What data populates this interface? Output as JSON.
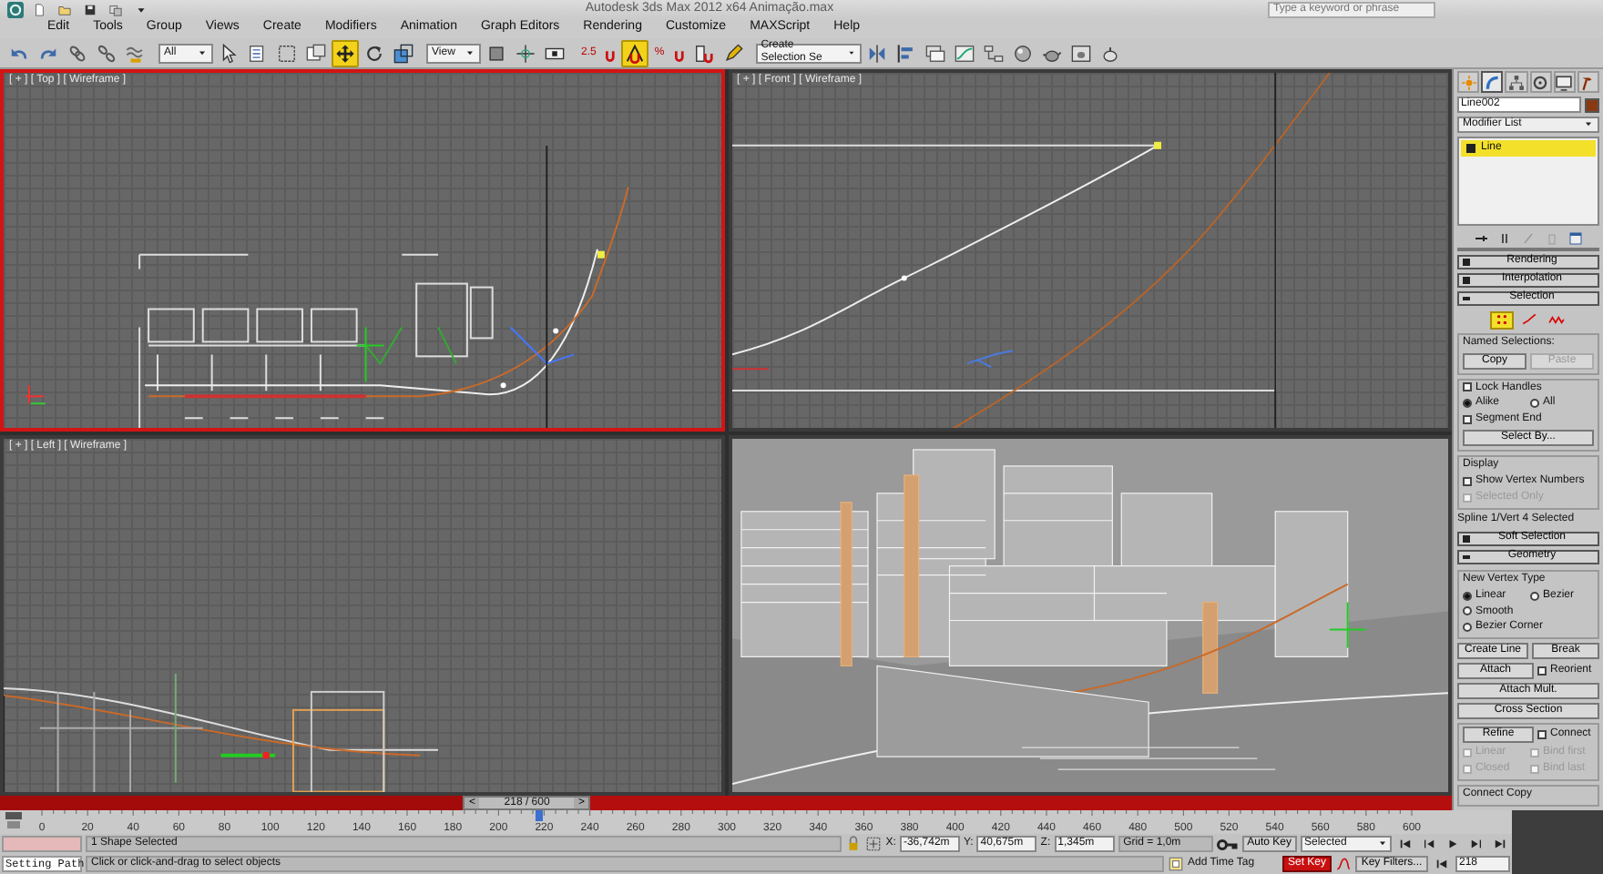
{
  "title_bar": {
    "title": "Autodesk 3ds Max 2012 x64    Animação.max",
    "search_placeholder": "Type a keyword or phrase"
  },
  "menu": [
    "Edit",
    "Tools",
    "Group",
    "Views",
    "Create",
    "Modifiers",
    "Animation",
    "Graph Editors",
    "Rendering",
    "Customize",
    "MAXScript",
    "Help"
  ],
  "toolbar": [
    {
      "kind": "undo",
      "selected": false
    },
    {
      "kind": "redo",
      "selected": false
    },
    {
      "kind": "link",
      "selected": false
    },
    {
      "kind": "unlink",
      "selected": false
    },
    {
      "kind": "bind",
      "selected": false
    },
    {
      "kind": "dropdown",
      "value": "All"
    },
    {
      "kind": "select",
      "selected": false
    },
    {
      "kind": "list",
      "selected": false
    },
    {
      "kind": "region",
      "selected": false
    },
    {
      "kind": "window",
      "selected": false
    },
    {
      "kind": "move",
      "selected": true
    },
    {
      "kind": "rotate",
      "selected": false
    },
    {
      "kind": "scale",
      "selected": false
    },
    {
      "kind": "dropdown",
      "value": "View"
    },
    {
      "kind": "pivot",
      "selected": false
    },
    {
      "kind": "manipulate",
      "selected": false
    },
    {
      "kind": "keyboard",
      "selected": false
    },
    {
      "kind": "snap",
      "label": "2.5",
      "selected": false
    },
    {
      "kind": "anglesnap",
      "selected": true
    },
    {
      "kind": "percent",
      "label": "%",
      "selected": false
    },
    {
      "kind": "spinner",
      "selected": false
    },
    {
      "kind": "pencil",
      "selected": false
    },
    {
      "kind": "dropdown",
      "value": "Create Selection Se"
    },
    {
      "kind": "mirror",
      "selected": false
    },
    {
      "kind": "align",
      "selected": false
    },
    {
      "kind": "layers",
      "selected": false
    },
    {
      "kind": "curve",
      "selected": false
    },
    {
      "kind": "schematic",
      "selected": false
    },
    {
      "kind": "material",
      "selected": false
    },
    {
      "kind": "rendersetup",
      "selected": false
    },
    {
      "kind": "framewindow",
      "selected": false
    },
    {
      "kind": "render",
      "selected": false
    }
  ],
  "viewports": [
    {
      "kind": "top",
      "label": "[ + ] [ Top ] [ Wireframe ]",
      "selected": true
    },
    {
      "kind": "front",
      "label": "[ + ] [ Front ] [ Wireframe ]",
      "selected": false
    },
    {
      "kind": "left",
      "label": "[ + ] [ Left ] [ Wireframe ]",
      "selected": false
    },
    {
      "kind": "perspective",
      "selected": false
    }
  ],
  "time_slider": {
    "prev": "<",
    "label": "218 / 600",
    "next": ">",
    "level": 0.363
  },
  "ruler_labels": [
    "0",
    "20",
    "40",
    "60",
    "80",
    "100",
    "120",
    "140",
    "160",
    "180",
    "200",
    "220",
    "240",
    "260",
    "280",
    "300",
    "320",
    "340",
    "360",
    "380",
    "400",
    "420",
    "440",
    "460",
    "480",
    "500",
    "520",
    "540",
    "560",
    "580",
    "600"
  ],
  "command_panel": {
    "tabs": [
      {
        "kind": "create",
        "selected": false
      },
      {
        "kind": "modify",
        "selected": true
      },
      {
        "kind": "hierarchy",
        "selected": false
      },
      {
        "kind": "motion",
        "selected": false
      },
      {
        "kind": "display",
        "selected": false
      },
      {
        "kind": "utilities",
        "selected": false
      }
    ],
    "object_name": "Line002",
    "color": "#8a3a12",
    "modifier_list": "Modifier List",
    "stack": [
      {
        "label": "Line",
        "selected": true
      }
    ],
    "rollouts": [
      {
        "title": "Rendering",
        "expanded": false
      },
      {
        "title": "Interpolation",
        "expanded": false
      },
      {
        "title": "Selection",
        "expanded": true,
        "content": [
          {
            "kind": "subobjects",
            "items": [
              {
                "kind": "vertex",
                "selected": true
              },
              {
                "kind": "segment",
                "selected": false
              },
              {
                "kind": "spline",
                "selected": false
              }
            ]
          },
          {
            "kind": "group",
            "label": "Named Selections:",
            "rows": [
              {
                "items": [
                  {
                    "kind": "button",
                    "label": "Copy",
                    "disabled": false
                  },
                  {
                    "kind": "button",
                    "label": "Paste",
                    "disabled": true
                  }
                ]
              }
            ]
          },
          {
            "kind": "group",
            "rows": [
              {
                "items": [
                  {
                    "kind": "checkbox",
                    "label": "Lock Handles",
                    "checked": false,
                    "disabled": false
                  }
                ]
              },
              {
                "items": [
                  {
                    "kind": "radio",
                    "label": "Alike",
                    "checked": true,
                    "disabled": false
                  },
                  {
                    "kind": "radio",
                    "label": "All",
                    "checked": false,
                    "disabled": false
                  }
                ]
              },
              {
                "items": [
                  {
                    "kind": "checkbox",
                    "label": "Segment End",
                    "checked": false,
                    "disabled": false
                  }
                ]
              },
              {
                "items": [
                  {
                    "kind": "button",
                    "label": "Select By...",
                    "disabled": false
                  }
                ]
              }
            ]
          },
          {
            "kind": "group",
            "label": "Display",
            "rows": [
              {
                "items": [
                  {
                    "kind": "checkbox",
                    "label": "Show Vertex Numbers",
                    "checked": false,
                    "disabled": false
                  }
                ]
              },
              {
                "items": [
                  {
                    "kind": "checkbox",
                    "label": "Selected Only",
                    "checked": false,
                    "disabled": true
                  }
                ]
              }
            ]
          },
          {
            "kind": "row",
            "items": [
              {
                "kind": "text",
                "label": "Spline 1/Vert 4 Selected"
              }
            ]
          }
        ]
      },
      {
        "title": "Soft Selection",
        "expanded": false
      },
      {
        "title": "Geometry",
        "expanded": true,
        "content": [
          {
            "kind": "group",
            "label": "New Vertex Type",
            "rows": [
              {
                "items": [
                  {
                    "kind": "radio",
                    "label": "Linear",
                    "checked": true,
                    "disabled": false
                  },
                  {
                    "kind": "radio",
                    "label": "Bezier",
                    "checked": false,
                    "disabled": false
                  }
                ]
              },
              {
                "items": [
                  {
                    "kind": "radio",
                    "label": "Smooth",
                    "checked": false,
                    "disabled": false
                  },
                  {
                    "kind": "radio",
                    "label": "Bezier Corner",
                    "checked": false,
                    "disabled": false
                  }
                ]
              }
            ]
          },
          {
            "kind": "row",
            "items": [
              {
                "kind": "button",
                "label": "Create Line",
                "disabled": false
              },
              {
                "kind": "button",
                "label": "Break",
                "disabled": false
              }
            ]
          },
          {
            "kind": "row",
            "items": [
              {
                "kind": "button",
                "label": "Attach",
                "disabled": false
              },
              {
                "kind": "checkbox",
                "label": "Reorient",
                "checked": false,
                "disabled": false
              }
            ]
          },
          {
            "kind": "row",
            "items": [
              {
                "kind": "button",
                "label": "Attach Mult.",
                "disabled": false
              }
            ]
          },
          {
            "kind": "row",
            "items": [
              {
                "kind": "button",
                "label": "Cross Section",
                "disabled": false
              }
            ]
          },
          {
            "kind": "group",
            "rows": [
              {
                "items": [
                  {
                    "kind": "button",
                    "label": "Refine",
                    "disabled": false
                  },
                  {
                    "kind": "checkbox",
                    "label": "Connect",
                    "checked": false,
                    "disabled": false
                  }
                ]
              },
              {
                "items": [
                  {
                    "kind": "checkbox",
                    "label": "Linear",
                    "checked": false,
                    "disabled": true
                  },
                  {
                    "kind": "checkbox",
                    "label": "Bind first",
                    "checked": false,
                    "disabled": true
                  }
                ]
              },
              {
                "items": [
                  {
                    "kind": "checkbox",
                    "label": "Closed",
                    "checked": false,
                    "disabled": true
                  },
                  {
                    "kind": "checkbox",
                    "label": "Bind last",
                    "checked": false,
                    "disabled": true
                  }
                ]
              }
            ]
          },
          {
            "kind": "group",
            "label": "Connect Copy"
          }
        ]
      }
    ]
  },
  "status_bar": {
    "listener_output": "Setting Path",
    "selection_info": "1 Shape Selected",
    "prompt": "Click or click-and-drag to select objects",
    "coord_labels": [
      "X:",
      "Y:",
      "Z:"
    ],
    "coords": [
      "-36,742m",
      "40,675m",
      "1,345m"
    ],
    "grid": "Grid = 1,0m",
    "add_time_tag": "Add Time Tag",
    "auto_key": "Auto Key",
    "key_mode": "Selected",
    "set_key": "Set Key",
    "key_filters": "Key Filters...",
    "frame": "218"
  }
}
